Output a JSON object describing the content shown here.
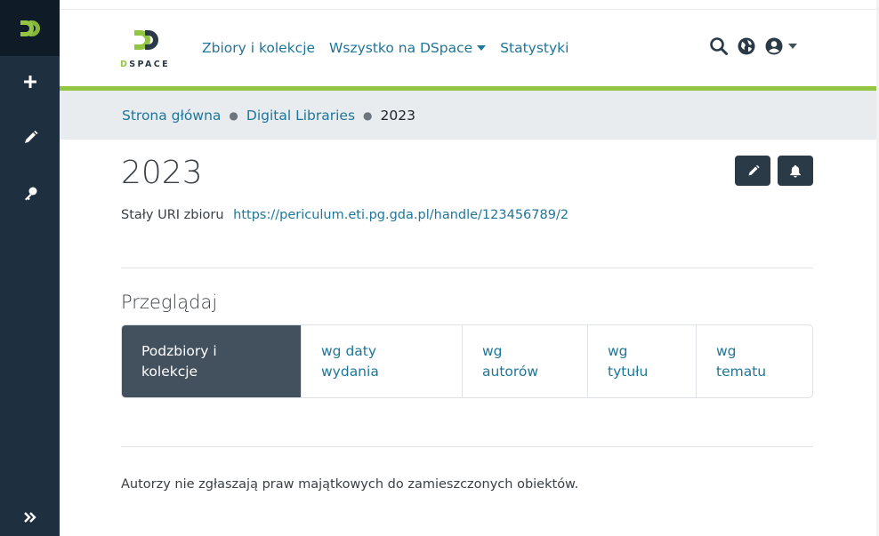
{
  "brand": {
    "wordmark_prefix": "D",
    "wordmark_rest": "SPACE",
    "accent": "#92c642",
    "sidebar_bg": "#1e2f3f"
  },
  "sidebar": {
    "items": [
      {
        "icon": "plus-icon"
      },
      {
        "icon": "pencil-icon"
      },
      {
        "icon": "key-icon"
      },
      {
        "icon": "double-chevron-right-icon"
      }
    ]
  },
  "header": {
    "nav": [
      {
        "label": "Zbiory i kolekcje"
      },
      {
        "label": "Wszystko na DSpace"
      },
      {
        "label": "Statystyki"
      }
    ],
    "icons": [
      "search-icon",
      "globe-icon",
      "user-icon"
    ]
  },
  "breadcrumb": {
    "items": [
      "Strona główna",
      "Digital Libraries",
      "2023"
    ]
  },
  "page": {
    "title": "2023",
    "uri_label": "Stały URI zbioru",
    "uri_value": "https://periculum.eti.pg.gda.pl/handle/123456789/2",
    "browse_heading": "Przeglądaj",
    "browse_options": [
      {
        "label": "Podzbiory i\nkolekcje",
        "active": true
      },
      {
        "label": "wg daty\nwydania",
        "active": false
      },
      {
        "label": "wg\nautorów",
        "active": false
      },
      {
        "label": "wg\ntytułu",
        "active": false
      },
      {
        "label": "wg\ntematu",
        "active": false
      }
    ],
    "footer_note": "Autorzy nie zgłaszają praw majątkowych do zamieszczonych obiektów."
  }
}
